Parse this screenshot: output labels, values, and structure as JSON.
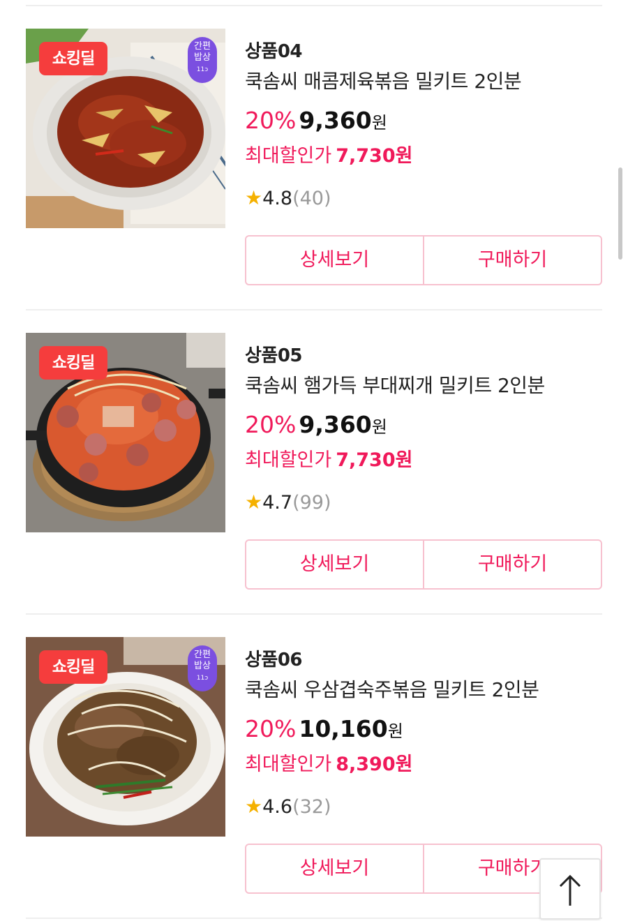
{
  "products": [
    {
      "deal_badge": "쇼킹딜",
      "meal_badge": {
        "line1": "간편",
        "line2": "밥상",
        "line3": "11ↄ"
      },
      "code": "상품04",
      "name": "쿡솜씨 매콤제육볶음 밀키트 2인분",
      "discount": "20%",
      "price": "9,360",
      "currency": "원",
      "max_discount_label": "최대할인가",
      "max_discount_price": "7,730원",
      "rating": "4.8",
      "review_count": "(40)",
      "detail_button": "상세보기",
      "buy_button": "구매하기"
    },
    {
      "deal_badge": "쇼킹딜",
      "code": "상품05",
      "name": "쿡솜씨 햄가득 부대찌개 밀키트 2인분",
      "discount": "20%",
      "price": "9,360",
      "currency": "원",
      "max_discount_label": "최대할인가",
      "max_discount_price": "7,730원",
      "rating": "4.7",
      "review_count": "(99)",
      "detail_button": "상세보기",
      "buy_button": "구매하기"
    },
    {
      "deal_badge": "쇼킹딜",
      "meal_badge": {
        "line1": "간편",
        "line2": "밥상",
        "line3": "11ↄ"
      },
      "code": "상품06",
      "name": "쿡솜씨 우삼겹숙주볶음 밀키트 2인분",
      "discount": "20%",
      "price": "10,160",
      "currency": "원",
      "max_discount_label": "최대할인가",
      "max_discount_price": "8,390원",
      "rating": "4.6",
      "review_count": "(32)",
      "detail_button": "상세보기",
      "buy_button": "구매하기"
    }
  ],
  "icons": {
    "star": "star-icon",
    "top": "arrow-up-icon"
  },
  "colors": {
    "accent": "#f0195a",
    "deal_badge": "#f53d3d",
    "meal_badge": "#7b4fe0",
    "star": "#f5b100",
    "button_border": "#f7c1cf"
  }
}
